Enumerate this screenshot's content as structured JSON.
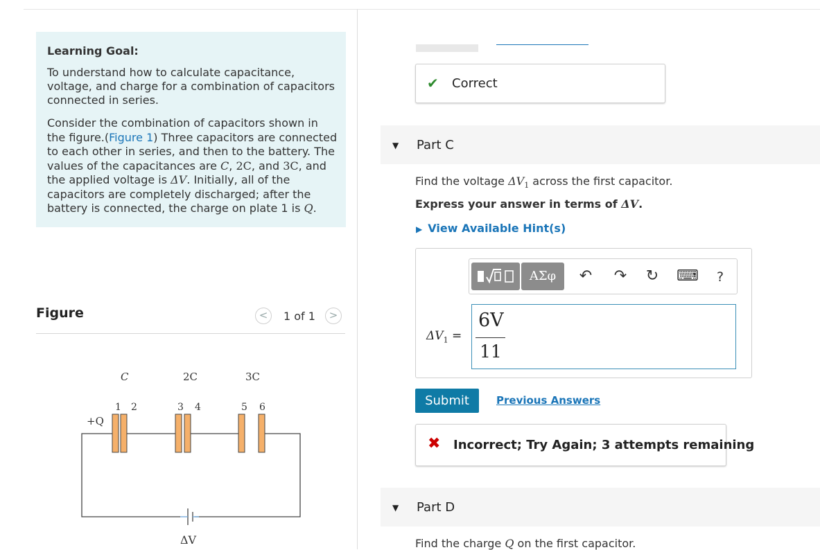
{
  "learning_goal": {
    "title": "Learning Goal:",
    "goal_text": "To understand how to calculate capacitance, voltage, and charge for a combination of capacitors connected in series.",
    "intro_1": "Consider the combination of capacitors shown in the figure.(",
    "figure_link": "Figure 1",
    "intro_2": ") Three capacitors are connected to each other in series, and then to the battery. The values of the capacitances are ",
    "c1": "C",
    "sep1": ", ",
    "c2": "2C",
    "sep2": ", and ",
    "c3": "3C",
    "intro_3": ", and the applied voltage is ",
    "dv": "ΔV",
    "intro_4": ". Initially, all of the capacitors are completely discharged; after the battery is connected, the charge on plate 1 is ",
    "q": "Q",
    "intro_end": "."
  },
  "figure": {
    "title": "Figure",
    "pager_text": "1 of 1",
    "prev_glyph": "<",
    "next_glyph": ">",
    "labels": {
      "c_c": "C",
      "c_2c": "2C",
      "c_3c": "3C",
      "p1": "1",
      "p2": "2",
      "p3": "3",
      "p4": "4",
      "p5": "5",
      "p6": "6",
      "plus_q": "+Q",
      "dv": "ΔV"
    },
    "plate_color": "#f5b06a"
  },
  "previous": {
    "correct_label": "Correct"
  },
  "part_c": {
    "label": "Part C",
    "question_1": "Find the voltage ",
    "question_var": "ΔV",
    "question_sub": "1",
    "question_2": " across the first capacitor.",
    "instruction_1": "Express your answer in terms of ",
    "instruction_var": "ΔV",
    "instruction_end": ".",
    "hint_label": "View Available Hint(s)",
    "toolbar": {
      "templates_icon": "templates-icon",
      "greek_label": "ΑΣφ",
      "undo_glyph": "↶",
      "redo_glyph": "↷",
      "reset_glyph": "↻",
      "keyboard_glyph": "⌨",
      "help_label": "?"
    },
    "answer_lhs": "ΔV",
    "answer_lhs_sub": "1",
    "answer_eq": "=",
    "answer_numerator": "6V",
    "answer_denominator": "11",
    "submit_label": "Submit",
    "previous_answers_label": "Previous Answers",
    "feedback_label": "Incorrect; Try Again; 3 attempts remaining"
  },
  "part_d": {
    "label": "Part D",
    "question_1": "Find the charge ",
    "question_var": "Q",
    "question_2": " on the first capacitor."
  },
  "colors": {
    "accent": "#1a75b8",
    "submit_bg": "#0f7ba6",
    "goal_bg": "#e6f4f6",
    "correct": "#2e8b2e",
    "incorrect": "#cc0000"
  }
}
